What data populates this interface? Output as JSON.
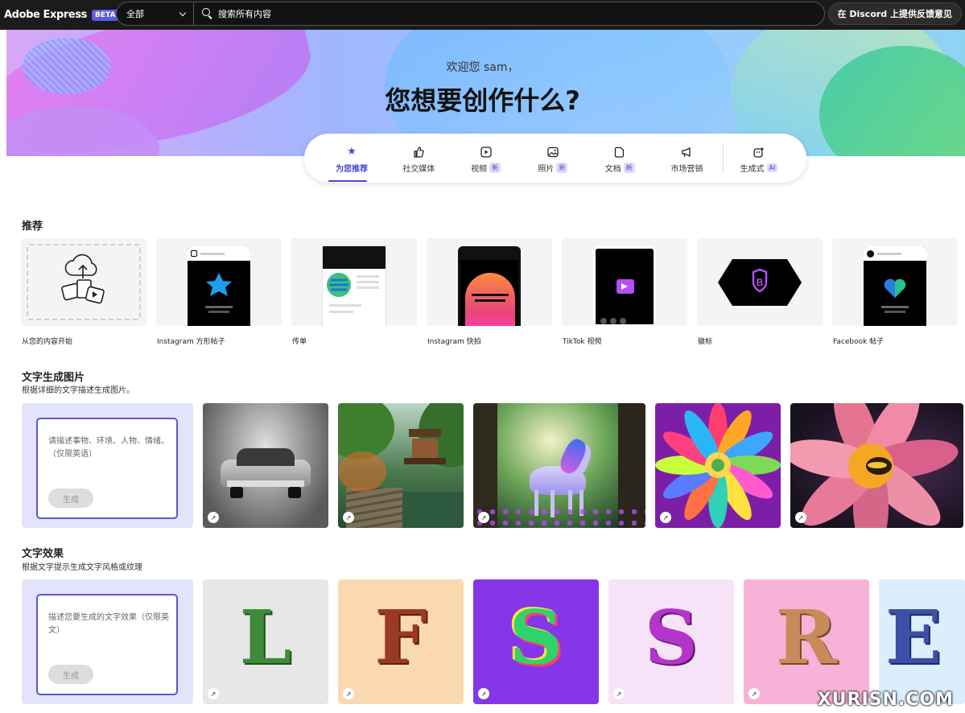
{
  "topbar": {
    "logo": "Adobe Express",
    "beta": "BETA",
    "scope": "全部",
    "search_placeholder": "搜索所有内容",
    "discord": "在 Discord 上提供反馈意见"
  },
  "hero": {
    "greeting": "欢迎您 sam，",
    "headline": "您想要创作什么?"
  },
  "tabs": [
    {
      "label": "为您推荐",
      "icon": "star-icon",
      "badge": ""
    },
    {
      "label": "社交媒体",
      "icon": "thumbs-up-icon",
      "badge": ""
    },
    {
      "label": "视频",
      "icon": "play-icon",
      "badge": "新"
    },
    {
      "label": "照片",
      "icon": "photo-icon",
      "badge": "新"
    },
    {
      "label": "文档",
      "icon": "document-icon",
      "badge": "新"
    },
    {
      "label": "市场营销",
      "icon": "megaphone-icon",
      "badge": ""
    },
    {
      "label": "生成式",
      "icon": "sparkle-icon",
      "badge": "AI"
    }
  ],
  "recommend": {
    "title": "推荐",
    "cards": [
      "从您的内容开始",
      "Instagram 方形帖子",
      "传单",
      "Instagram 快拍",
      "TikTok 视频",
      "徽标",
      "Facebook 帖子"
    ]
  },
  "text_to_image": {
    "title": "文字生成图片",
    "subtitle": "根据详细的文字描述生成图片。",
    "placeholder": "请描述事物、环境、人物、情绪。（仅限英语）",
    "button": "生成"
  },
  "text_effects": {
    "title": "文字效果",
    "subtitle": "根据文字提示生成文字风格或纹理",
    "placeholder": "描述您要生成的文字效果（仅限英文）",
    "button": "生成",
    "letters": [
      "L",
      "F",
      "S",
      "S",
      "R",
      "E"
    ]
  },
  "watermark": "XURISN.COM",
  "colors": {
    "accent": "#4a44d6",
    "topbar": "#1b1b1b"
  }
}
